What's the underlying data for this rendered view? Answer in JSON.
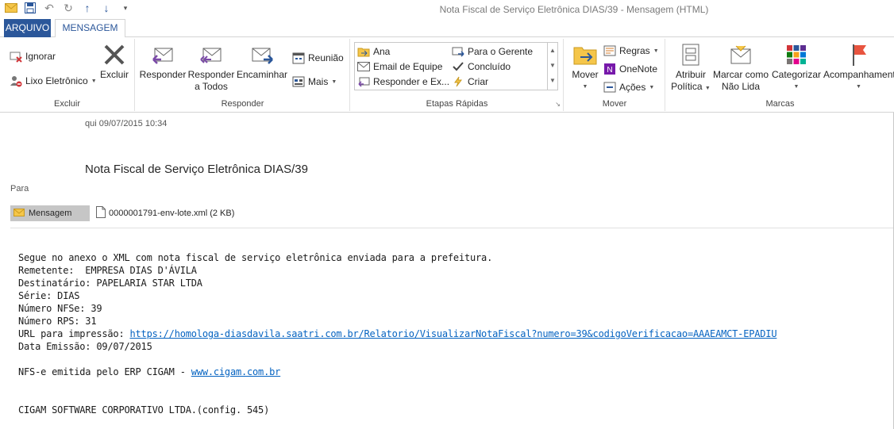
{
  "window": {
    "title": "Nota Fiscal de Serviço Eletrônica DIAS/39 - Mensagem (HTML)"
  },
  "tabs": {
    "file": "ARQUIVO",
    "message": "MENSAGEM"
  },
  "ribbon": {
    "excluir": {
      "label": "Excluir",
      "ignore": "Ignorar",
      "junk": "Lixo Eletrônico",
      "delete": "Excluir"
    },
    "responder": {
      "label": "Responder",
      "reply": "Responder",
      "reply_all_1": "Responder",
      "reply_all_2": "a Todos",
      "forward": "Encaminhar",
      "meeting": "Reunião",
      "more": "Mais"
    },
    "quicksteps": {
      "label": "Etapas Rápidas",
      "items": [
        "Ana",
        "Email de Equipe",
        "Responder e Ex...",
        "Para o Gerente",
        "Concluído",
        "Criar"
      ]
    },
    "mover": {
      "label": "Mover",
      "move": "Mover",
      "rules": "Regras",
      "onenote": "OneNote",
      "actions": "Ações"
    },
    "marcas": {
      "label": "Marcas",
      "policy_1": "Atribuir",
      "policy_2": "Política",
      "unread_1": "Marcar como",
      "unread_2": "Não Lida",
      "categorize": "Categorizar",
      "followup": "Acompanhamento"
    }
  },
  "message": {
    "date": "qui 09/07/2015 10:34",
    "subject": "Nota Fiscal de Serviço Eletrônica DIAS/39",
    "to_label": "Para",
    "attach_tab": "Mensagem",
    "attachment": "0000001791-env-lote.xml (2 KB)"
  },
  "body": {
    "line1": "Segue no anexo o XML com nota fiscal de serviço eletrônica enviada para a prefeitura.",
    "line2": "Remetente:  EMPRESA DIAS D'ÁVILA",
    "line3": "Destinatário: PAPELARIA STAR LTDA",
    "line4": "Série: DIAS",
    "line5": "Número NFSe: 39",
    "line6": "Número RPS: 31",
    "url_label": "URL para impressão: ",
    "url": "https://homologa-diasdavila.saatri.com.br/Relatorio/VisualizarNotaFiscal?numero=39&codigoVerificacao=AAAEAMCT-EPADIU",
    "line8": "Data Emissão: 09/07/2015",
    "erp_label": "NFS-e emitida pelo ERP CIGAM - ",
    "erp_link": "www.cigam.com.br",
    "footer": "CIGAM SOFTWARE CORPORATIVO LTDA.(config. 545)"
  },
  "colors": {
    "accent": "#2b579a",
    "link": "#0563c1"
  }
}
